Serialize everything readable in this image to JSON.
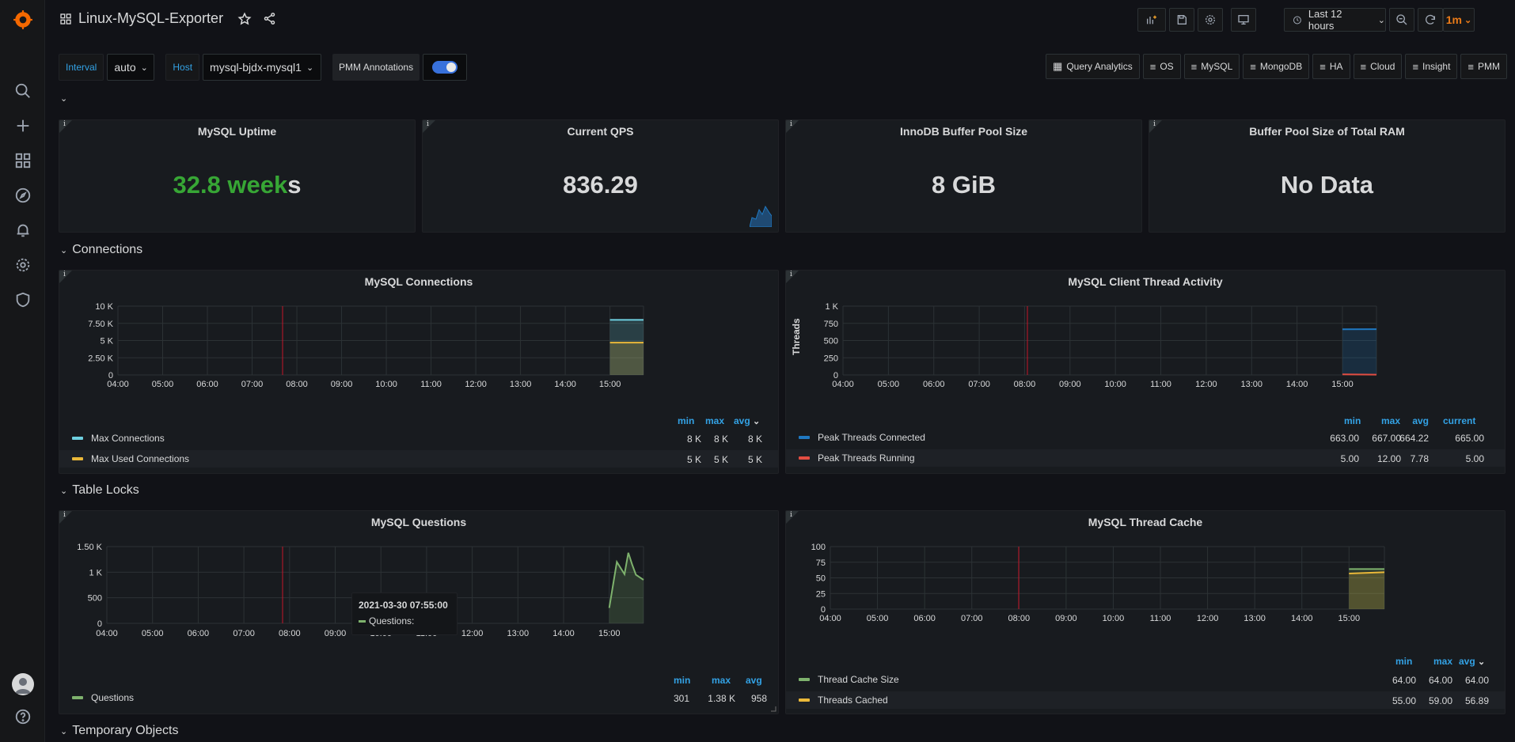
{
  "header": {
    "title": "Linux-MySQL-Exporter",
    "time_range": "Last 12 hours",
    "refresh_interval": "1m"
  },
  "variables": {
    "interval_label": "Interval",
    "interval_value": "auto",
    "host_label": "Host",
    "host_value": "mysql-bjdx-mysql1",
    "annotations_label": "PMM Annotations",
    "annotations_enabled": true
  },
  "links": [
    {
      "label": "Query Analytics",
      "icon": "apps-icon"
    },
    {
      "label": "OS",
      "icon": "bars-icon"
    },
    {
      "label": "MySQL",
      "icon": "bars-icon"
    },
    {
      "label": "MongoDB",
      "icon": "bars-icon"
    },
    {
      "label": "HA",
      "icon": "bars-icon"
    },
    {
      "label": "Cloud",
      "icon": "bars-icon"
    },
    {
      "label": "Insight",
      "icon": "bars-icon"
    },
    {
      "label": "PMM",
      "icon": "bars-icon"
    }
  ],
  "rows": {
    "connections": "Connections",
    "table_locks": "Table Locks",
    "temporary_objects": "Temporary Objects"
  },
  "stats": {
    "uptime": {
      "title": "MySQL Uptime",
      "value_main": "32.8 week",
      "value_suffix": "s"
    },
    "qps": {
      "title": "Current QPS",
      "value": "836.29"
    },
    "buffer_pool": {
      "title": "InnoDB Buffer Pool Size",
      "value": "8 GiB"
    },
    "buffer_pool_ram": {
      "title": "Buffer Pool Size of Total RAM",
      "value": "No Data"
    }
  },
  "time_axis": [
    "04:00",
    "05:00",
    "06:00",
    "07:00",
    "08:00",
    "09:00",
    "10:00",
    "11:00",
    "12:00",
    "13:00",
    "14:00",
    "15:00"
  ],
  "panels": {
    "connections": {
      "title": "MySQL Connections",
      "y_ticks": [
        "10 K",
        "7.50 K",
        "5 K",
        "2.50 K",
        "0"
      ],
      "legend_cols": [
        "min",
        "max",
        "avg"
      ],
      "series": [
        {
          "name": "Max Connections",
          "color": "#6ed0e0",
          "min": "8 K",
          "max": "8 K",
          "avg": "8 K"
        },
        {
          "name": "Max Used Connections",
          "color": "#eab839",
          "min": "5 K",
          "max": "5 K",
          "avg": "5 K"
        }
      ]
    },
    "client_threads": {
      "title": "MySQL Client Thread Activity",
      "ylabel": "Threads",
      "y_ticks": [
        "1 K",
        "750",
        "500",
        "250",
        "0"
      ],
      "legend_cols": [
        "min",
        "max",
        "avg",
        "current"
      ],
      "series": [
        {
          "name": "Peak Threads Connected",
          "color": "#1f78c1",
          "min": "663.00",
          "max": "667.00",
          "avg": "664.22",
          "current": "665.00"
        },
        {
          "name": "Peak Threads Running",
          "color": "#e24d42",
          "min": "5.00",
          "max": "12.00",
          "avg": "7.78",
          "current": "5.00"
        }
      ]
    },
    "questions": {
      "title": "MySQL Questions",
      "y_ticks": [
        "1.50 K",
        "1 K",
        "500",
        "0"
      ],
      "legend_cols": [
        "min",
        "max",
        "avg"
      ],
      "series": [
        {
          "name": "Questions",
          "color": "#7eb26d",
          "min": "301",
          "max": "1.38 K",
          "avg": "958"
        }
      ],
      "tooltip_time": "2021-03-30 07:55:00",
      "tooltip_series": "Questions:"
    },
    "thread_cache": {
      "title": "MySQL Thread Cache",
      "y_ticks": [
        "100",
        "75",
        "50",
        "25",
        "0"
      ],
      "legend_cols": [
        "min",
        "max",
        "avg"
      ],
      "series": [
        {
          "name": "Thread Cache Size",
          "color": "#7eb26d",
          "min": "64.00",
          "max": "64.00",
          "avg": "64.00"
        },
        {
          "name": "Threads Cached",
          "color": "#eab839",
          "min": "55.00",
          "max": "59.00",
          "avg": "56.89"
        }
      ]
    }
  },
  "chart_data": [
    {
      "type": "line",
      "title": "MySQL Connections",
      "ylim": [
        0,
        10000
      ],
      "x": [
        "15:00",
        "15:45"
      ],
      "series": [
        {
          "name": "Max Connections",
          "values": [
            8000,
            8000
          ]
        },
        {
          "name": "Max Used Connections",
          "values": [
            4700,
            4700
          ]
        }
      ]
    },
    {
      "type": "area",
      "title": "MySQL Client Thread Activity",
      "ylabel": "Threads",
      "ylim": [
        0,
        1000
      ],
      "x": [
        "15:00",
        "15:45"
      ],
      "series": [
        {
          "name": "Peak Threads Connected",
          "values": [
            664,
            665
          ]
        },
        {
          "name": "Peak Threads Running",
          "values": [
            8,
            5
          ]
        }
      ]
    },
    {
      "type": "area",
      "title": "MySQL Questions",
      "ylim": [
        0,
        1500
      ],
      "x": [
        "15:00",
        "15:10",
        "15:20",
        "15:25",
        "15:30",
        "15:35",
        "15:40",
        "15:45"
      ],
      "series": [
        {
          "name": "Questions",
          "values": [
            301,
            1200,
            960,
            1380,
            1150,
            950,
            900,
            850
          ]
        }
      ]
    },
    {
      "type": "area",
      "title": "MySQL Thread Cache",
      "ylim": [
        0,
        100
      ],
      "x": [
        "15:00",
        "15:45"
      ],
      "series": [
        {
          "name": "Thread Cache Size",
          "values": [
            64,
            64
          ]
        },
        {
          "name": "Threads Cached",
          "values": [
            57,
            59
          ]
        }
      ]
    }
  ]
}
